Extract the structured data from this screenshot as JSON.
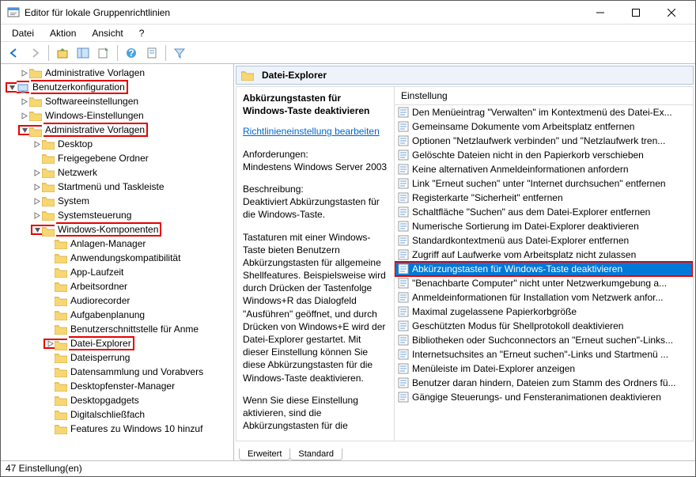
{
  "window": {
    "title": "Editor für lokale Gruppenrichtlinien"
  },
  "menu": {
    "file": "Datei",
    "action": "Aktion",
    "view": "Ansicht",
    "help": "?"
  },
  "tree": {
    "admin_templates": "Administrative Vorlagen",
    "user_config": "Benutzerkonfiguration",
    "software": "Softwareeinstellungen",
    "windows_settings": "Windows-Einstellungen",
    "admin_templates2": "Administrative Vorlagen",
    "desktop": "Desktop",
    "shared_folders": "Freigegebene Ordner",
    "network": "Netzwerk",
    "startmenu": "Startmenü und Taskleiste",
    "system": "System",
    "control_panel": "Systemsteuerung",
    "win_components": "Windows-Komponenten",
    "attachment_mgr": "Anlagen-Manager",
    "app_compat": "Anwendungskompatibilität",
    "app_runtime": "App-Laufzeit",
    "work_folders": "Arbeitsordner",
    "audio_rec": "Audiorecorder",
    "task_sched": "Aufgabenplanung",
    "ui_credprov": "Benutzerschnittstelle für Anme",
    "file_explorer": "Datei-Explorer",
    "file_lock": "Dateisperrung",
    "data_collection": "Datensammlung und Vorabvers",
    "dwm": "Desktopfenster-Manager",
    "gadgets": "Desktopgadgets",
    "digital_locker": "Digitalschließfach",
    "win10_features": "Features zu Windows 10 hinzuf"
  },
  "right": {
    "header": "Datei-Explorer",
    "selected_title": "Abkürzungstasten für Windows-Taste deaktivieren",
    "edit_link": "Richtlinieneinstellung bearbeiten",
    "req_label": "Anforderungen:",
    "req_value": "Mindestens Windows Server 2003",
    "desc_label": "Beschreibung:",
    "desc_value": "Deaktiviert Abkürzungstasten für die Windows-Taste.",
    "desc_long1": "Tastaturen mit einer Windows-Taste bieten Benutzern Abkürzungstasten für allgemeine Shellfeatures. Beispielsweise wird durch Drücken der Tastenfolge Windows+R das Dialogfeld \"Ausführen\" geöffnet, und durch Drücken von Windows+E wird der Datei-Explorer gestartet. Mit dieser Einstellung können Sie diese Abkürzungstasten für die Windows-Taste deaktivieren.",
    "desc_long2": "Wenn Sie diese Einstellung aktivieren, sind die Abkürzungstasten für die",
    "col_header": "Einstellung",
    "items": [
      "Den Menüeintrag \"Verwalten\" im Kontextmenü des Datei-Ex...",
      "Gemeinsame Dokumente vom Arbeitsplatz entfernen",
      "Optionen \"Netzlaufwerk verbinden\" und \"Netzlaufwerk tren...",
      "Gelöschte Dateien nicht in den Papierkorb verschieben",
      "Keine alternativen Anmeldeinformationen anfordern",
      "Link \"Erneut suchen\" unter \"Internet durchsuchen\" entfernen",
      "Registerkarte \"Sicherheit\" entfernen",
      "Schaltfläche \"Suchen\" aus dem Datei-Explorer entfernen",
      "Numerische Sortierung im Datei-Explorer deaktivieren",
      "Standardkontextmenü aus Datei-Explorer entfernen",
      "Zugriff auf Laufwerke vom Arbeitsplatz nicht zulassen",
      "Abkürzungstasten für Windows-Taste deaktivieren",
      "\"Benachbarte Computer\" nicht unter Netzwerkumgebung a...",
      "Anmeldeinformationen für Installation vom Netzwerk anfor...",
      "Maximal zugelassene Papierkorbgröße",
      "Geschützten Modus für Shellprotokoll deaktivieren",
      "Bibliotheken oder Suchconnectors an \"Erneut suchen\"-Links...",
      "Internetsuchsites an \"Erneut suchen\"-Links und Startmenü ...",
      "Menüleiste im Datei-Explorer anzeigen",
      "Benutzer daran hindern, Dateien zum Stamm des Ordners fü...",
      "Gängige Steuerungs- und Fensteranimationen deaktivieren"
    ],
    "selected_index": 11
  },
  "tabs": {
    "extended": "Erweitert",
    "standard": "Standard"
  },
  "status": "47 Einstellung(en)"
}
